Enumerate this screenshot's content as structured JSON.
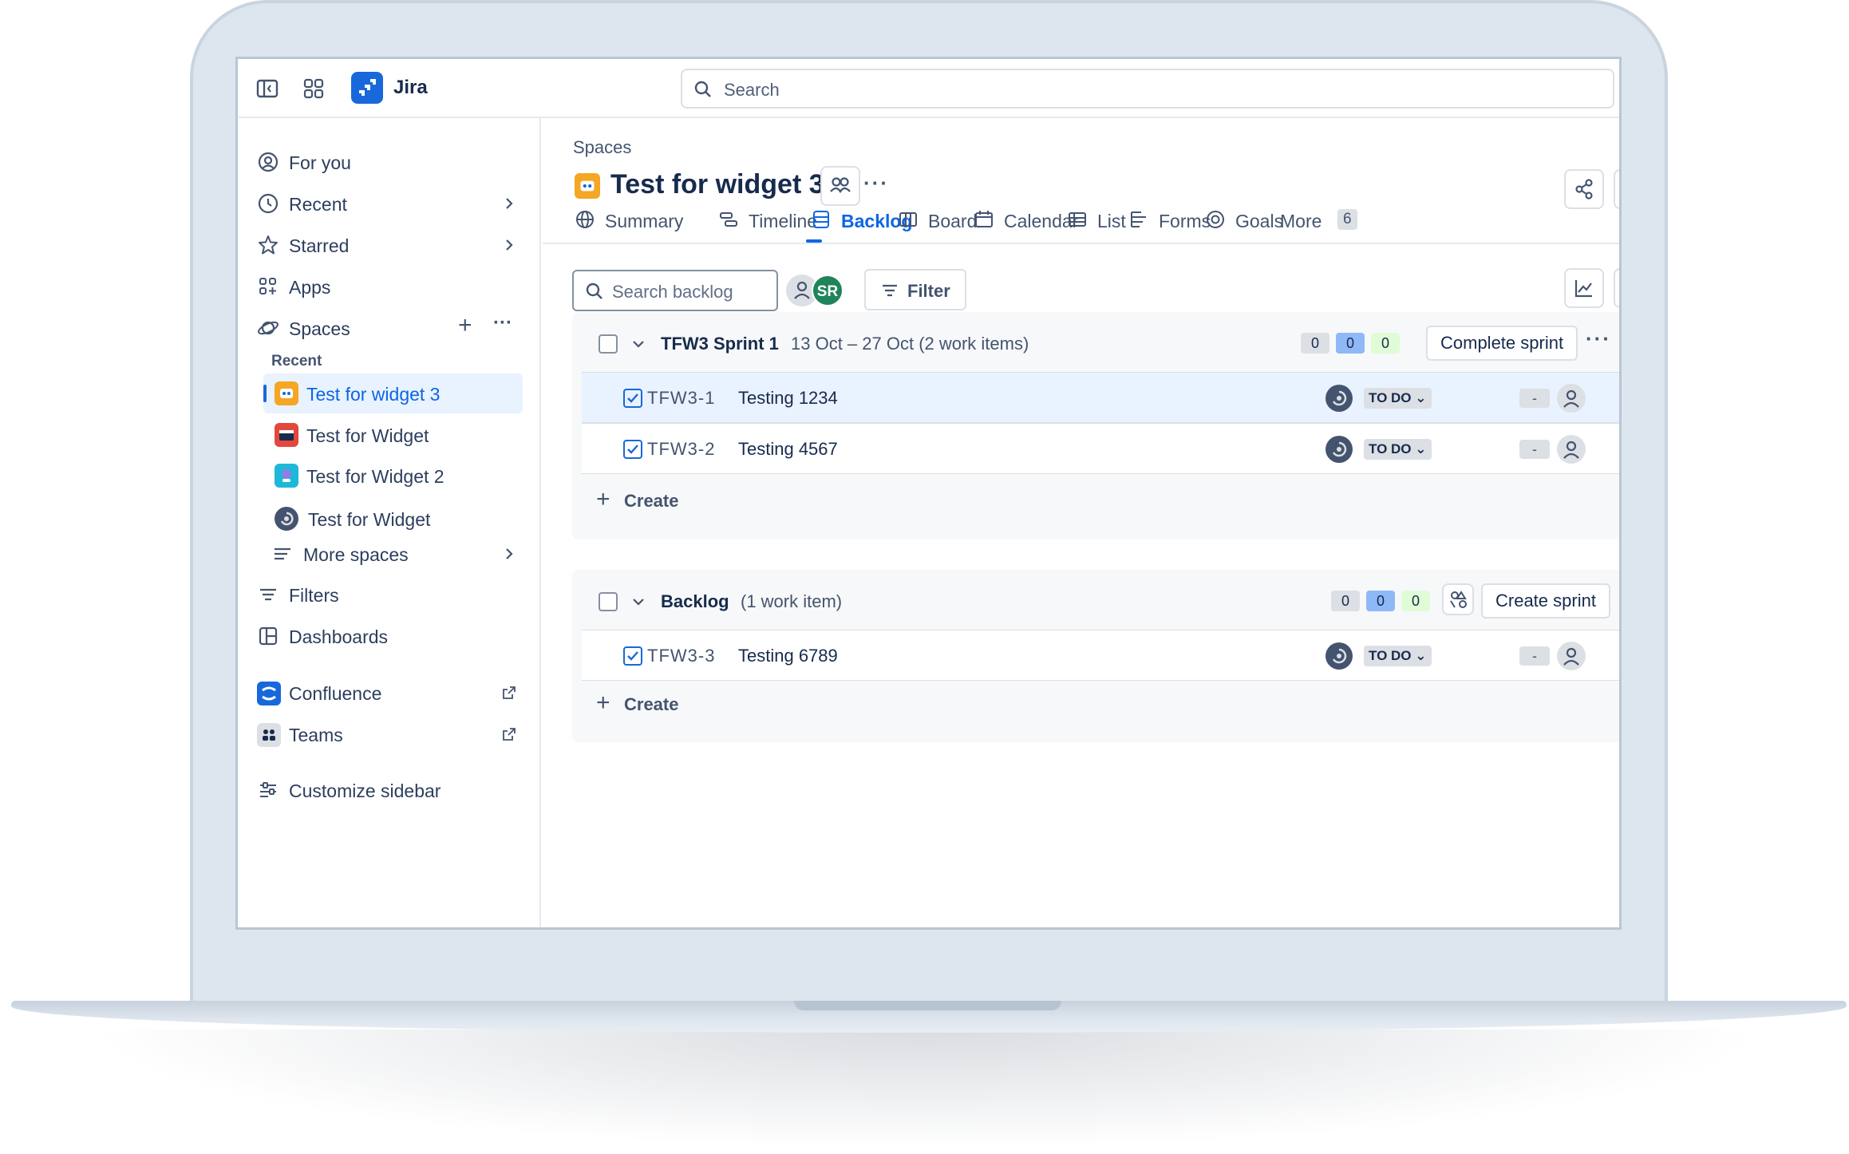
{
  "app": {
    "name": "Jira"
  },
  "search": {
    "placeholder": "Search"
  },
  "sidebar": {
    "items": [
      {
        "label": "For you"
      },
      {
        "label": "Recent"
      },
      {
        "label": "Starred"
      },
      {
        "label": "Apps"
      },
      {
        "label": "Spaces"
      }
    ],
    "recent_section_label": "Recent",
    "spaces": [
      {
        "label": "Test for widget 3",
        "active": true
      },
      {
        "label": "Test for Widget"
      },
      {
        "label": "Test for Widget 2"
      },
      {
        "label": "Test for Widget"
      }
    ],
    "more_spaces": "More spaces",
    "filters": "Filters",
    "dashboards": "Dashboards",
    "confluence": "Confluence",
    "teams": "Teams",
    "customize": "Customize sidebar"
  },
  "main": {
    "breadcrumb": "Spaces",
    "title": "Test for widget 3",
    "more_tab_count": "6",
    "tabs": [
      {
        "label": "Summary"
      },
      {
        "label": "Timeline"
      },
      {
        "label": "Backlog",
        "active": true
      },
      {
        "label": "Board"
      },
      {
        "label": "Calendar"
      },
      {
        "label": "List"
      },
      {
        "label": "Forms"
      },
      {
        "label": "Goals"
      },
      {
        "label": "More"
      }
    ],
    "search_backlog_placeholder": "Search backlog",
    "avatar_initials": "SR",
    "filter_label": "Filter"
  },
  "sprint": {
    "name": "TFW3 Sprint 1",
    "meta": "13 Oct – 27 Oct (2 work items)",
    "counts": [
      "0",
      "0",
      "0"
    ],
    "complete_label": "Complete sprint",
    "items": [
      {
        "key": "TFW3-1",
        "summary": "Testing 1234",
        "status": "TO DO",
        "estimate": "-",
        "selected": true
      },
      {
        "key": "TFW3-2",
        "summary": "Testing 4567",
        "status": "TO DO",
        "estimate": "-"
      }
    ],
    "create_label": "Create"
  },
  "backlog": {
    "name": "Backlog",
    "meta": "(1 work item)",
    "counts": [
      "0",
      "0",
      "0"
    ],
    "create_sprint_label": "Create sprint",
    "items": [
      {
        "key": "TFW3-3",
        "summary": "Testing 6789",
        "status": "TO DO",
        "estimate": "-"
      }
    ],
    "create_label": "Create"
  },
  "colors": {
    "accent": "#0c66e4",
    "selected_row": "#e9f2ff",
    "brand": "#1868db"
  }
}
